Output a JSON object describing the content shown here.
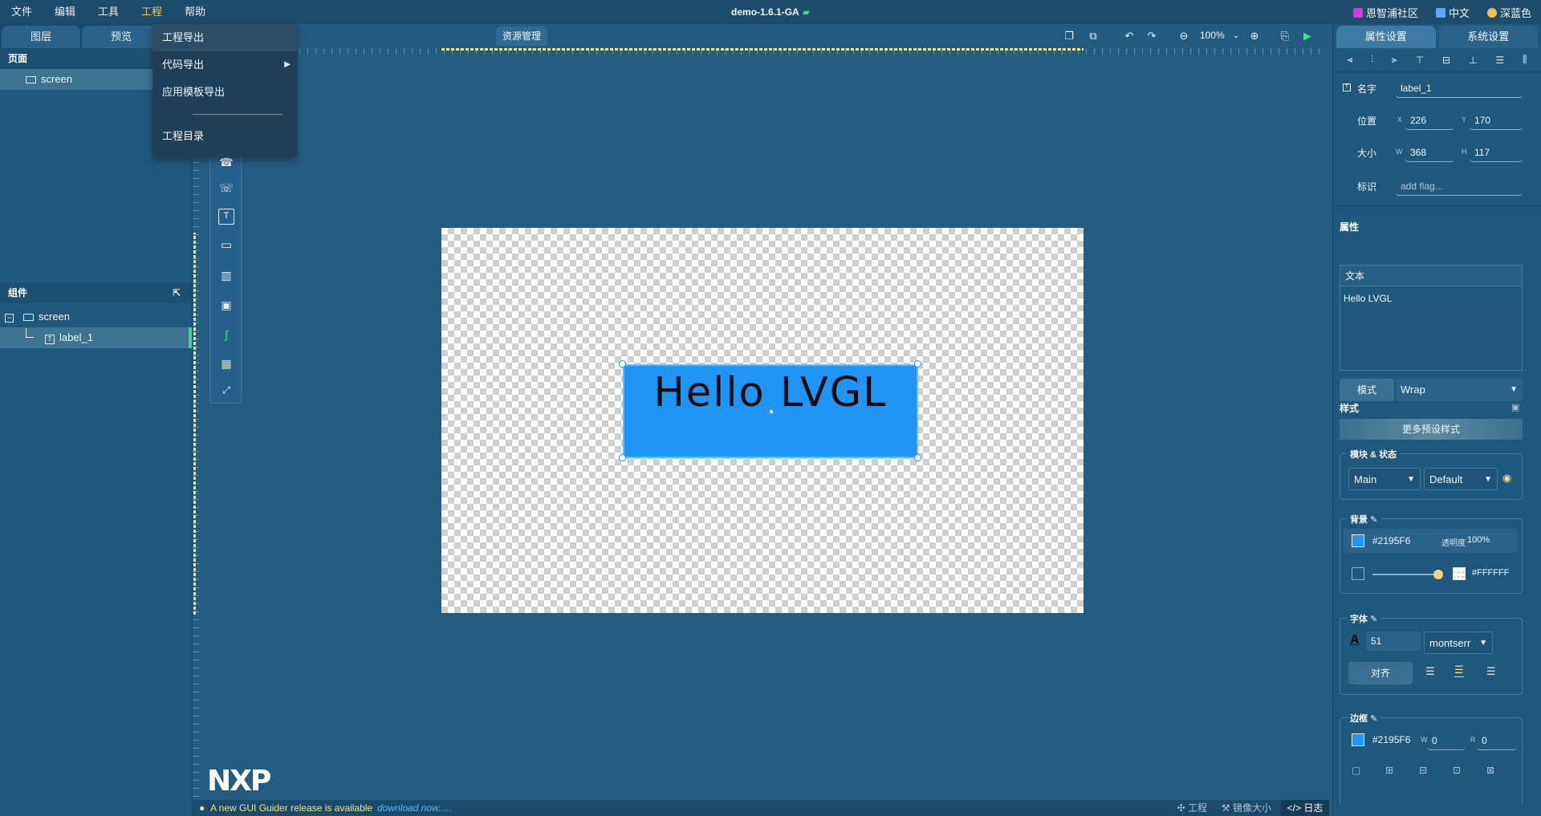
{
  "menu": {
    "items": [
      "文件",
      "编辑",
      "工具",
      "工程",
      "帮助"
    ],
    "active_index": 3,
    "title": "demo-1.6.1-GA",
    "right": {
      "community": "恩智浦社区",
      "language": "中文",
      "theme": "深蓝色"
    }
  },
  "dropdown": {
    "items": [
      {
        "label": "工程导出",
        "highlighted": true,
        "submenu": false
      },
      {
        "label": "代码导出",
        "highlighted": false,
        "submenu": true
      },
      {
        "label": "应用模板导出",
        "highlighted": false,
        "submenu": false
      },
      {
        "label": "工程目录",
        "highlighted": false,
        "submenu": false
      }
    ]
  },
  "left": {
    "tabs": [
      "图层",
      "预览"
    ],
    "pages_header": "页面",
    "pages": [
      "screen"
    ],
    "components_header": "组件",
    "tree": [
      {
        "label": "screen",
        "level": 0
      },
      {
        "label": "label_1",
        "level": 1
      }
    ]
  },
  "canvas_toolbar": {
    "resource_tab": "资源管理",
    "zoom": "100%"
  },
  "stage": {
    "label_text": "Hello LVGL",
    "label_color": "#2195F6",
    "logo": "NXP"
  },
  "statusbar": {
    "message": "A new GUI Guider release is available",
    "download": "download now.....",
    "project": "工程",
    "mirror": "镜像大小",
    "log": "日志"
  },
  "right": {
    "tabs": [
      "属性设置",
      "系统设置"
    ],
    "name_label": "名字",
    "name_value": "label_1",
    "position_label": "位置",
    "x_key": "X",
    "x_value": "226",
    "y_key": "Y",
    "y_value": "170",
    "size_label": "大小",
    "w_key": "W",
    "w_value": "368",
    "h_key": "H",
    "h_value": "117",
    "flag_label": "标识",
    "flag_placeholder": "add flag...",
    "attrs_head": "属性",
    "text_head": "文本",
    "text_value": "Hello LVGL",
    "mode_label": "模式",
    "mode_value": "Wrap",
    "style_head": "样式",
    "more_styles": "更多预设样式",
    "part_state_title": "模块 & 状态",
    "part_value": "Main",
    "state_value": "Default",
    "bg_title": "背景",
    "bg_color": "#2195F6",
    "opacity_label": "透明度",
    "opacity_value": "100%",
    "grad_color": "#FFFFFF",
    "font_title": "字体",
    "font_size": "51",
    "font_family": "montserr",
    "align_label": "对齐",
    "border_title": "边框",
    "border_color": "#2195F6",
    "border_w_key": "W",
    "border_w_value": "0",
    "border_r_key": "R",
    "border_r_value": "0"
  }
}
